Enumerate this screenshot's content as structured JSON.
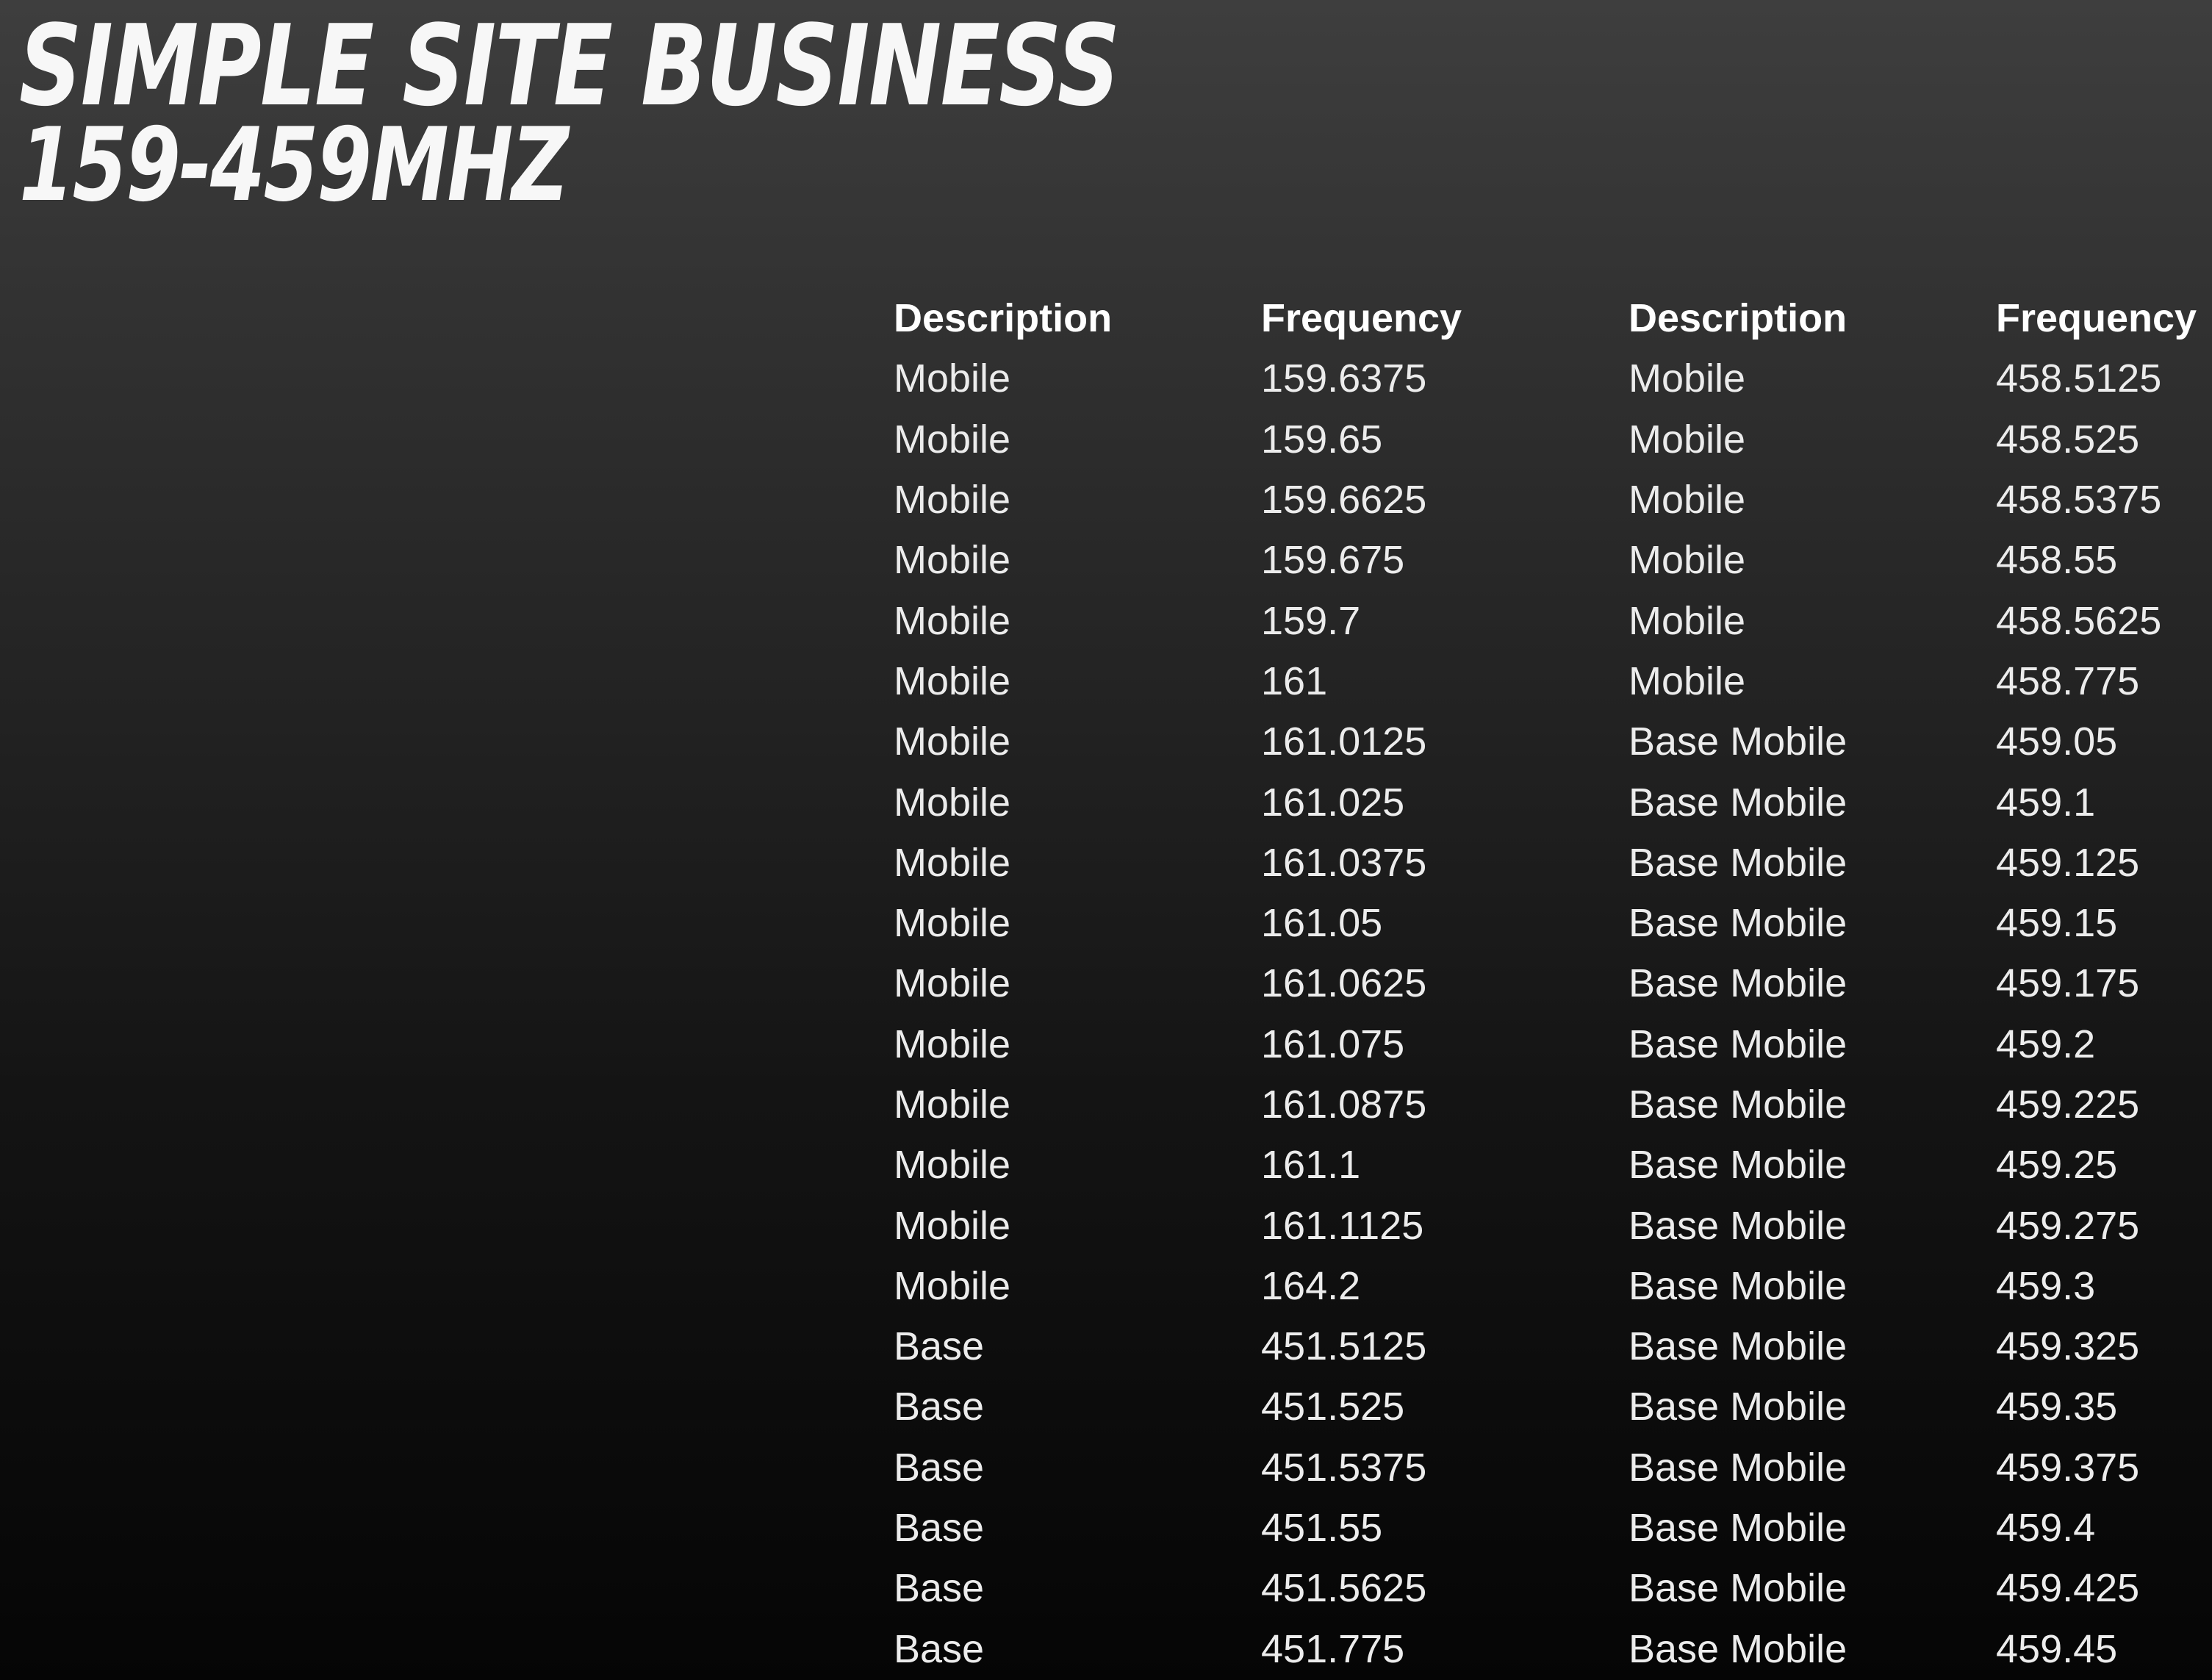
{
  "title": "SIMPLE SITE BUSINESS",
  "subtitle": "159-459MHZ",
  "table": {
    "headers": [
      "Description",
      "Frequency",
      "Description",
      "Frequency"
    ],
    "rows": [
      [
        "Mobile",
        "159.6375",
        "Mobile",
        "458.5125"
      ],
      [
        "Mobile",
        "159.65",
        "Mobile",
        "458.525"
      ],
      [
        "Mobile",
        "159.6625",
        "Mobile",
        "458.5375"
      ],
      [
        "Mobile",
        "159.675",
        "Mobile",
        "458.55"
      ],
      [
        "Mobile",
        "159.7",
        "Mobile",
        "458.5625"
      ],
      [
        "Mobile",
        "161",
        "Mobile",
        "458.775"
      ],
      [
        "Mobile",
        "161.0125",
        "Base Mobile",
        "459.05"
      ],
      [
        "Mobile",
        "161.025",
        "Base Mobile",
        "459.1"
      ],
      [
        "Mobile",
        "161.0375",
        "Base Mobile",
        "459.125"
      ],
      [
        "Mobile",
        "161.05",
        "Base Mobile",
        "459.15"
      ],
      [
        "Mobile",
        "161.0625",
        "Base Mobile",
        "459.175"
      ],
      [
        "Mobile",
        "161.075",
        "Base Mobile",
        "459.2"
      ],
      [
        "Mobile",
        "161.0875",
        "Base Mobile",
        "459.225"
      ],
      [
        "Mobile",
        "161.1",
        "Base Mobile",
        "459.25"
      ],
      [
        "Mobile",
        "161.1125",
        "Base Mobile",
        "459.275"
      ],
      [
        "Mobile",
        "164.2",
        "Base Mobile",
        "459.3"
      ],
      [
        "Base",
        "451.5125",
        "Base Mobile",
        "459.325"
      ],
      [
        "Base",
        "451.525",
        "Base Mobile",
        "459.35"
      ],
      [
        "Base",
        "451.5375",
        "Base Mobile",
        "459.375"
      ],
      [
        "Base",
        "451.55",
        "Base Mobile",
        "459.4"
      ],
      [
        "Base",
        "451.5625",
        "Base Mobile",
        "459.425"
      ],
      [
        "Base",
        "451.775",
        "Base Mobile",
        "459.45"
      ]
    ]
  }
}
